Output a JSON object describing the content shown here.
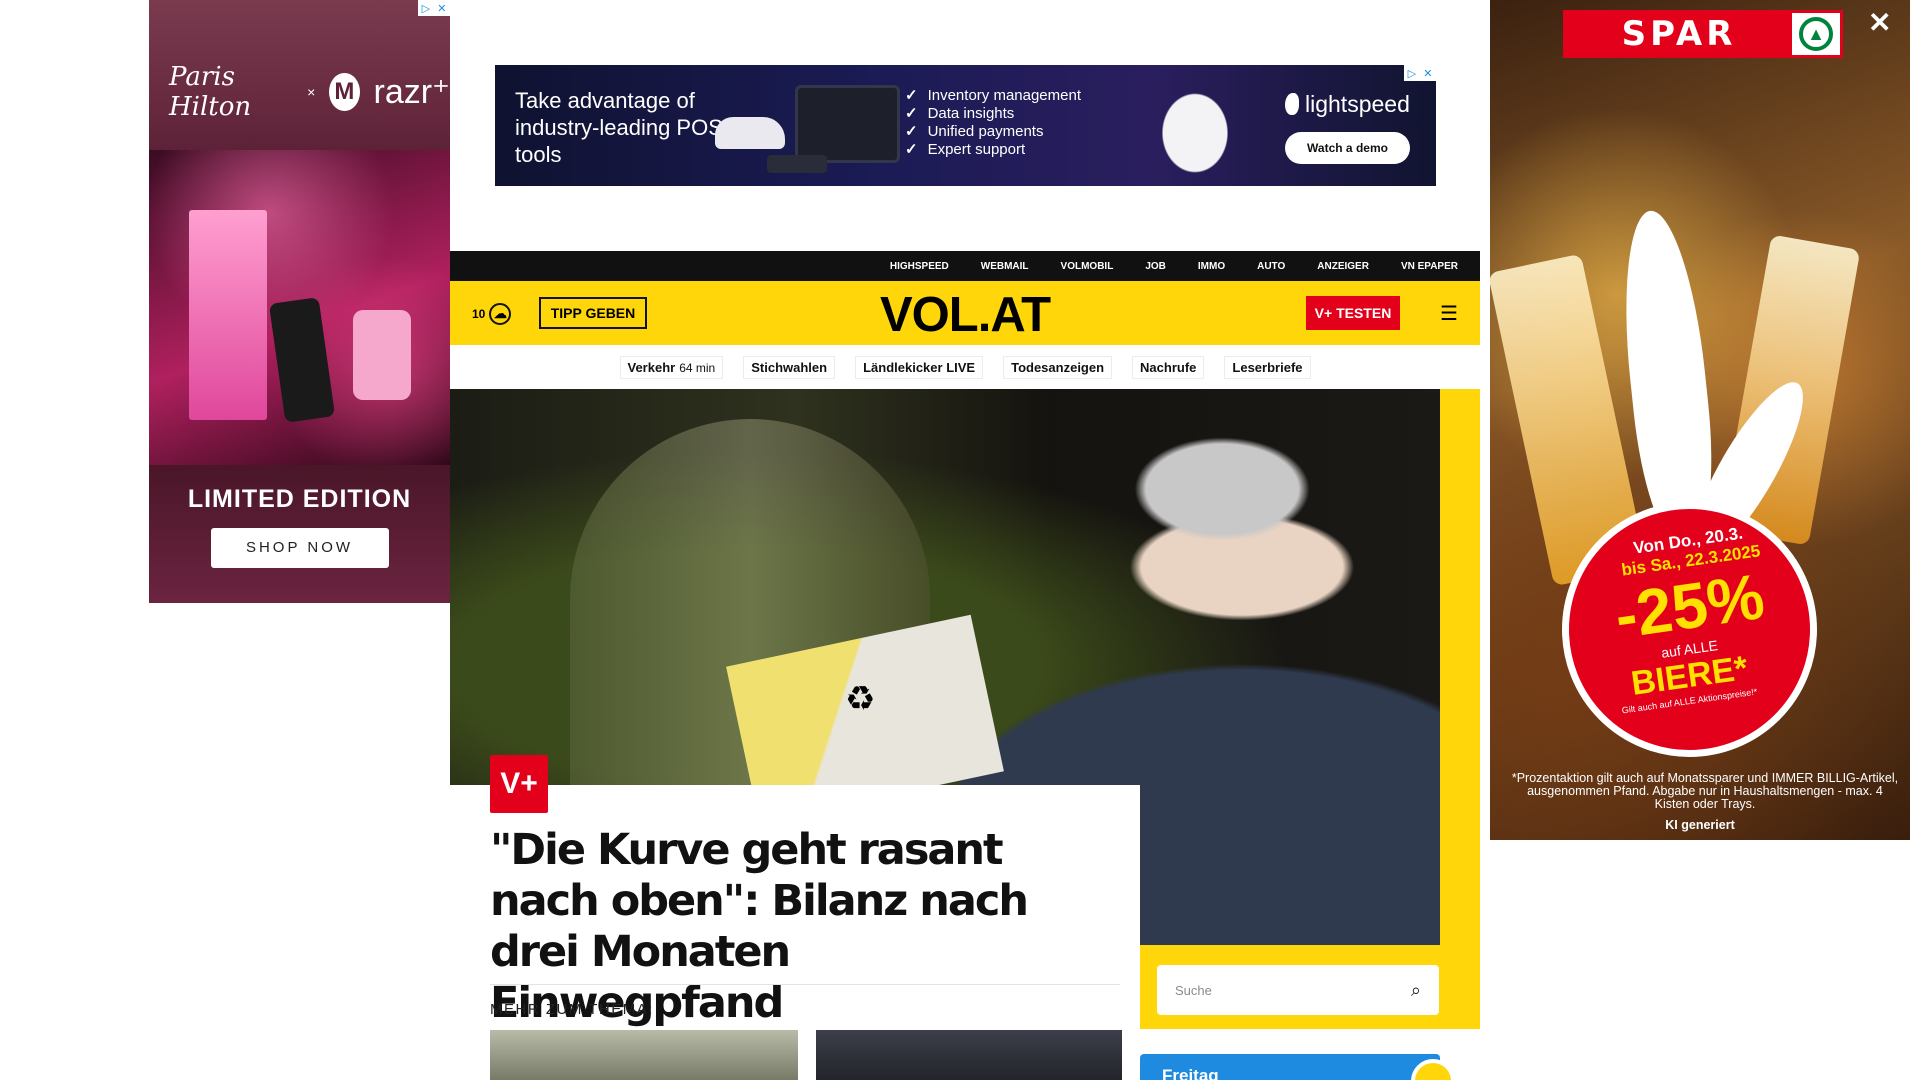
{
  "ad_left": {
    "brand_signature": "Paris Hilton",
    "times": "×",
    "partner": "razr⁺",
    "partner_logo": "M",
    "headline": "LIMITED EDITION",
    "cta": "SHOP NOW"
  },
  "ad_top": {
    "headline": "Take advantage of industry-leading POS tools",
    "bullets": [
      "Inventory management",
      "Data insights",
      "Unified payments",
      "Expert support"
    ],
    "brand": "lightspeed",
    "cta": "Watch a demo"
  },
  "ad_right": {
    "brand": "SPAR",
    "close": "✕",
    "date_line1": "Von Do., 20.3.",
    "date_line2": "bis Sa., 22.3.2025",
    "discount": "-25%",
    "auf": "auf ALLE",
    "product": "BIERE*",
    "small": "Gilt auch auf ALLE Aktionspreise!*",
    "note": "*Prozentaktion gilt auch auf Monatssparer und IMMER BILLIG-Artikel, ausgenommen Pfand. Abgabe nur in Haushaltsmengen - max. 4 Kisten oder Trays.",
    "ki": "KI generiert"
  },
  "topbar": [
    "HIGHSPEED",
    "WEBMAIL",
    "VOLMOBIL",
    "JOB",
    "IMMO",
    "AUTO",
    "ANZEIGER",
    "VN EPAPER"
  ],
  "header": {
    "temperature": "10",
    "tipp": "TIPP GEBEN",
    "logo": "VOL.AT",
    "vplus": "V+ TESTEN"
  },
  "subnav": {
    "verkehr": "Verkehr",
    "verkehr_min": "64 min",
    "items": [
      "Stichwahlen",
      "Ländlekicker LIVE",
      "Todesanzeigen",
      "Nachrufe",
      "Leserbriefe"
    ]
  },
  "hero": {
    "badge": "V+",
    "headline": "\"Die Kurve geht rasant nach oben\": Bilanz nach drei Monaten Einwegpfand",
    "mehr": "MEHR ZUM THEMA:"
  },
  "search": {
    "placeholder": "Suche"
  },
  "weather_box": {
    "day": "Freitag"
  },
  "colors": {
    "brand_yellow": "#ffd60a",
    "accent_red": "#e2001a",
    "spar_green": "#00843d",
    "weather_blue": "#1f8be0"
  }
}
